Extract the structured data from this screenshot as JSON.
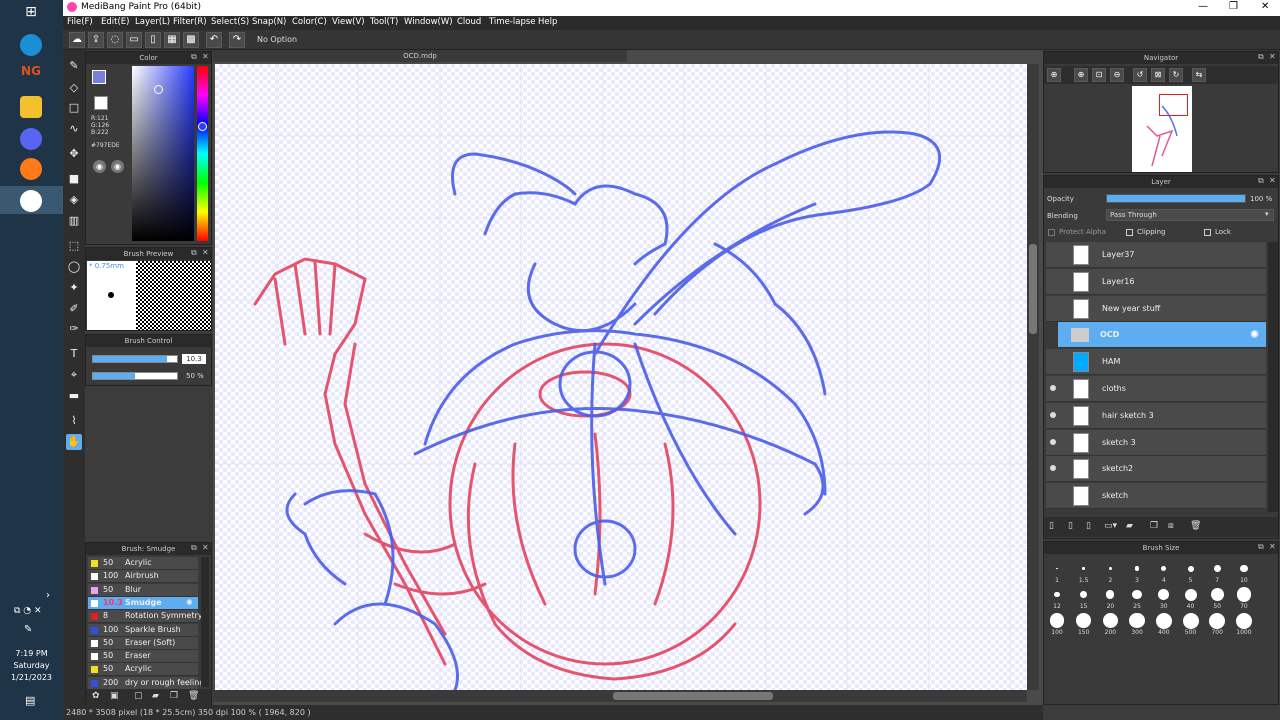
{
  "window": {
    "title": "MediBang Paint Pro (64bit)"
  },
  "menu": [
    "File(F)",
    "Edit(E)",
    "Layer(L)",
    "Filter(R)",
    "Select(S)",
    "Snap(N)",
    "Color(C)",
    "View(V)",
    "Tool(T)",
    "Window(W)",
    "Cloud",
    "Time-lapse",
    "Help"
  ],
  "toolbar": {
    "option_label": "No Option"
  },
  "taskbar": {
    "time": "7:19 PM",
    "day": "Saturday",
    "date": "1/21/2023"
  },
  "color_panel": {
    "title": "Color",
    "r": "R:121",
    "g": "G:126",
    "b": "B:222",
    "hex": "#797EDE",
    "primary": "#797EDE",
    "secondary": "#FFFFFF"
  },
  "brush_preview": {
    "title": "Brush Preview",
    "size": "* 0.75mm"
  },
  "brush_control": {
    "title": "Brush Control",
    "size_value": "10.3",
    "opacity_value": "50 %",
    "opacity_fraction": 0.5,
    "size_fraction": 0.88
  },
  "brush_list": {
    "title": "Brush: Smudge",
    "items": [
      {
        "size": "50",
        "name": "Acrylic",
        "color": "#f0e020"
      },
      {
        "size": "100",
        "name": "Airbrush",
        "color": "#ffffff"
      },
      {
        "size": "50",
        "name": "Blur",
        "color": "#f0a0f0"
      },
      {
        "size": "10.3",
        "name": "Smudge",
        "color": "#ffffff",
        "selected": true
      },
      {
        "size": "8",
        "name": "Rotation Symmetry",
        "color": "#e02020"
      },
      {
        "size": "100",
        "name": "Sparkle Brush",
        "color": "#3050e0"
      },
      {
        "size": "50",
        "name": "Eraser (Soft)",
        "color": "#ffffff"
      },
      {
        "size": "50",
        "name": "Eraser",
        "color": "#ffffff"
      },
      {
        "size": "50",
        "name": "Acrylic",
        "color": "#f0e020"
      },
      {
        "size": "200",
        "name": "dry or rough feeling",
        "color": "#3050e0"
      }
    ]
  },
  "document": {
    "tab": "OCD.mdp"
  },
  "status": {
    "text": "2480 * 3508 pixel  (18 * 25.5cm)  350 dpi  100 %  ( 1964, 820 )"
  },
  "navigator": {
    "title": "Navigator"
  },
  "layer_panel": {
    "title": "Layer",
    "opacity_label": "Opacity",
    "opacity_value": "100 %",
    "opacity_fraction": 1.0,
    "blending_label": "Blending",
    "blending_value": "Pass Through",
    "protect_alpha": "Protect Alpha",
    "clipping": "Clipping",
    "lock": "Lock",
    "layers": [
      {
        "name": "Layer37",
        "visible": false
      },
      {
        "name": "Layer16",
        "visible": false
      },
      {
        "name": "New year stuff",
        "visible": false
      },
      {
        "name": "OCD",
        "visible": false,
        "folder": true,
        "selected": true
      },
      {
        "name": "HAM",
        "visible": false,
        "thumb": "#00aaff"
      },
      {
        "name": "cloths",
        "visible": true
      },
      {
        "name": "hair sketch 3",
        "visible": true
      },
      {
        "name": "sketch 3",
        "visible": true
      },
      {
        "name": "sketch2",
        "visible": true
      },
      {
        "name": "sketch",
        "visible": false
      }
    ]
  },
  "brush_size": {
    "title": "Brush Size",
    "sizes": [
      "1",
      "1.5",
      "2",
      "3",
      "4",
      "5",
      "7",
      "10",
      "12",
      "15",
      "20",
      "25",
      "30",
      "40",
      "50",
      "70",
      "100",
      "150",
      "200",
      "300",
      "400",
      "500",
      "700",
      "1000"
    ]
  }
}
